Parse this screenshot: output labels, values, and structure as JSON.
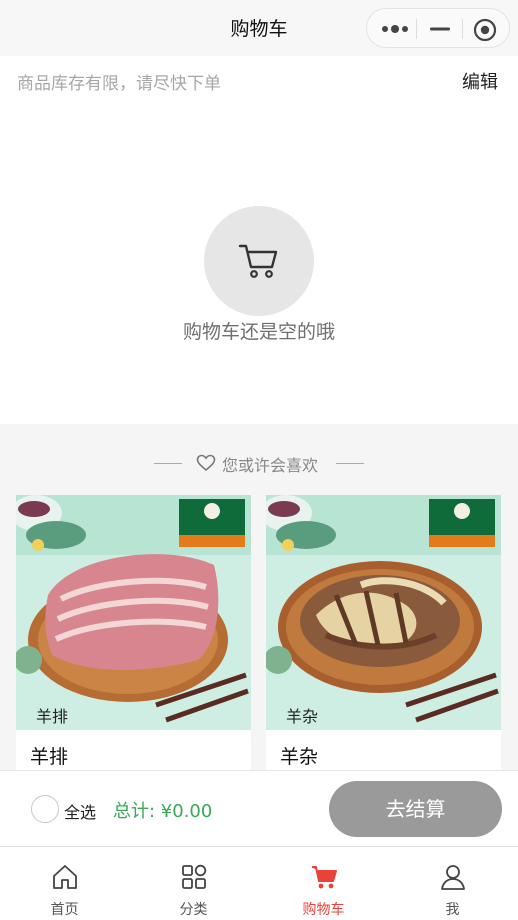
{
  "navbar": {
    "title": "购物车",
    "capsule": {
      "more_icon": "more-dots-icon",
      "minimize_icon": "minimize-icon",
      "close_icon": "target-close-icon"
    }
  },
  "notice": {
    "text": "商品库存有限，请尽快下单",
    "edit_label": "编辑"
  },
  "empty": {
    "icon": "cart-icon",
    "text": "购物车还是空的哦"
  },
  "recommend": {
    "title": "您或许会喜欢",
    "icon": "heart-icon",
    "items": [
      {
        "name": "羊排",
        "photo_tag": "羊排"
      },
      {
        "name": "羊杂",
        "photo_tag": "羊杂"
      }
    ]
  },
  "checkout": {
    "select_all_label": "全选",
    "total_label": "总计: ¥0.00",
    "pay_label": "去结算",
    "colors": {
      "total": "#3aa858",
      "pay_bg": "#9a9a9a"
    }
  },
  "tabbar": {
    "active_color": "#e8433b",
    "items": [
      {
        "label": "首页",
        "icon": "home-icon"
      },
      {
        "label": "分类",
        "icon": "category-icon"
      },
      {
        "label": "购物车",
        "icon": "cart-icon",
        "active": true
      },
      {
        "label": "我",
        "icon": "user-icon"
      }
    ]
  }
}
